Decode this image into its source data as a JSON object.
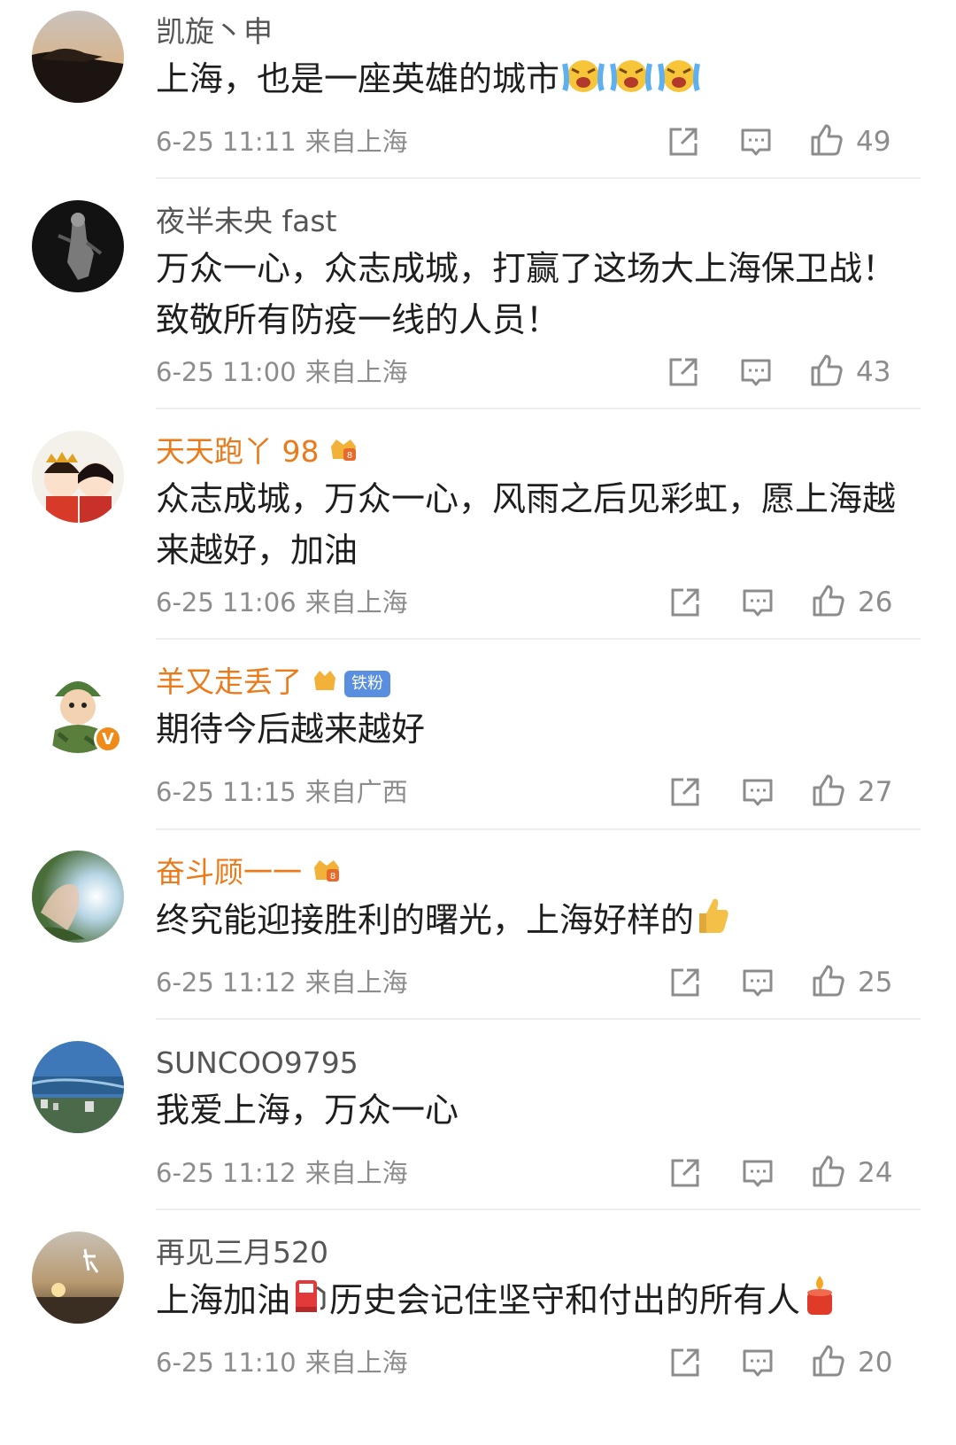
{
  "comments": [
    {
      "username": "凯旋丶申",
      "text": "上海，也是一座英雄的城市",
      "time": "6-25 11:11",
      "location": "来自上海",
      "likes": "49"
    },
    {
      "username": "夜半未央 fast",
      "text": "万众一心，众志成城，打赢了这场大上海保卫战！致敬所有防疫一线的人员！",
      "time": "6-25 11:00",
      "location": "来自上海",
      "likes": "43"
    },
    {
      "username": "天天跑丫 98",
      "text": "众志成城，万众一心，风雨之后见彩虹，愿上海越来越好，加油",
      "time": "6-25 11:06",
      "location": "来自上海",
      "likes": "26"
    },
    {
      "username": "羊又走丢了",
      "badge": "铁粉",
      "text": "期待今后越来越好",
      "time": "6-25 11:15",
      "location": "来自广西",
      "likes": "27"
    },
    {
      "username": "奋斗顾一一",
      "text": "终究能迎接胜利的曙光，上海好样的",
      "time": "6-25 11:12",
      "location": "来自上海",
      "likes": "25"
    },
    {
      "username": "SUNCOO9795",
      "text": "我爱上海，万众一心",
      "time": "6-25 11:12",
      "location": "来自上海",
      "likes": "24"
    },
    {
      "username": "再见三月520",
      "text_part1": "上海加油",
      "text_part2": "历史会记住坚守和付出的所有人",
      "time": "6-25 11:10",
      "location": "来自上海",
      "likes": "20"
    }
  ],
  "colors": {
    "fan_name": "#ea7a1a",
    "normal_name": "#555555",
    "meta": "#8c8c8c",
    "verified_badge": "#f08a18"
  },
  "icons": {
    "share": "share-icon",
    "reply": "comment-icon",
    "like": "thumbs-up-icon"
  }
}
